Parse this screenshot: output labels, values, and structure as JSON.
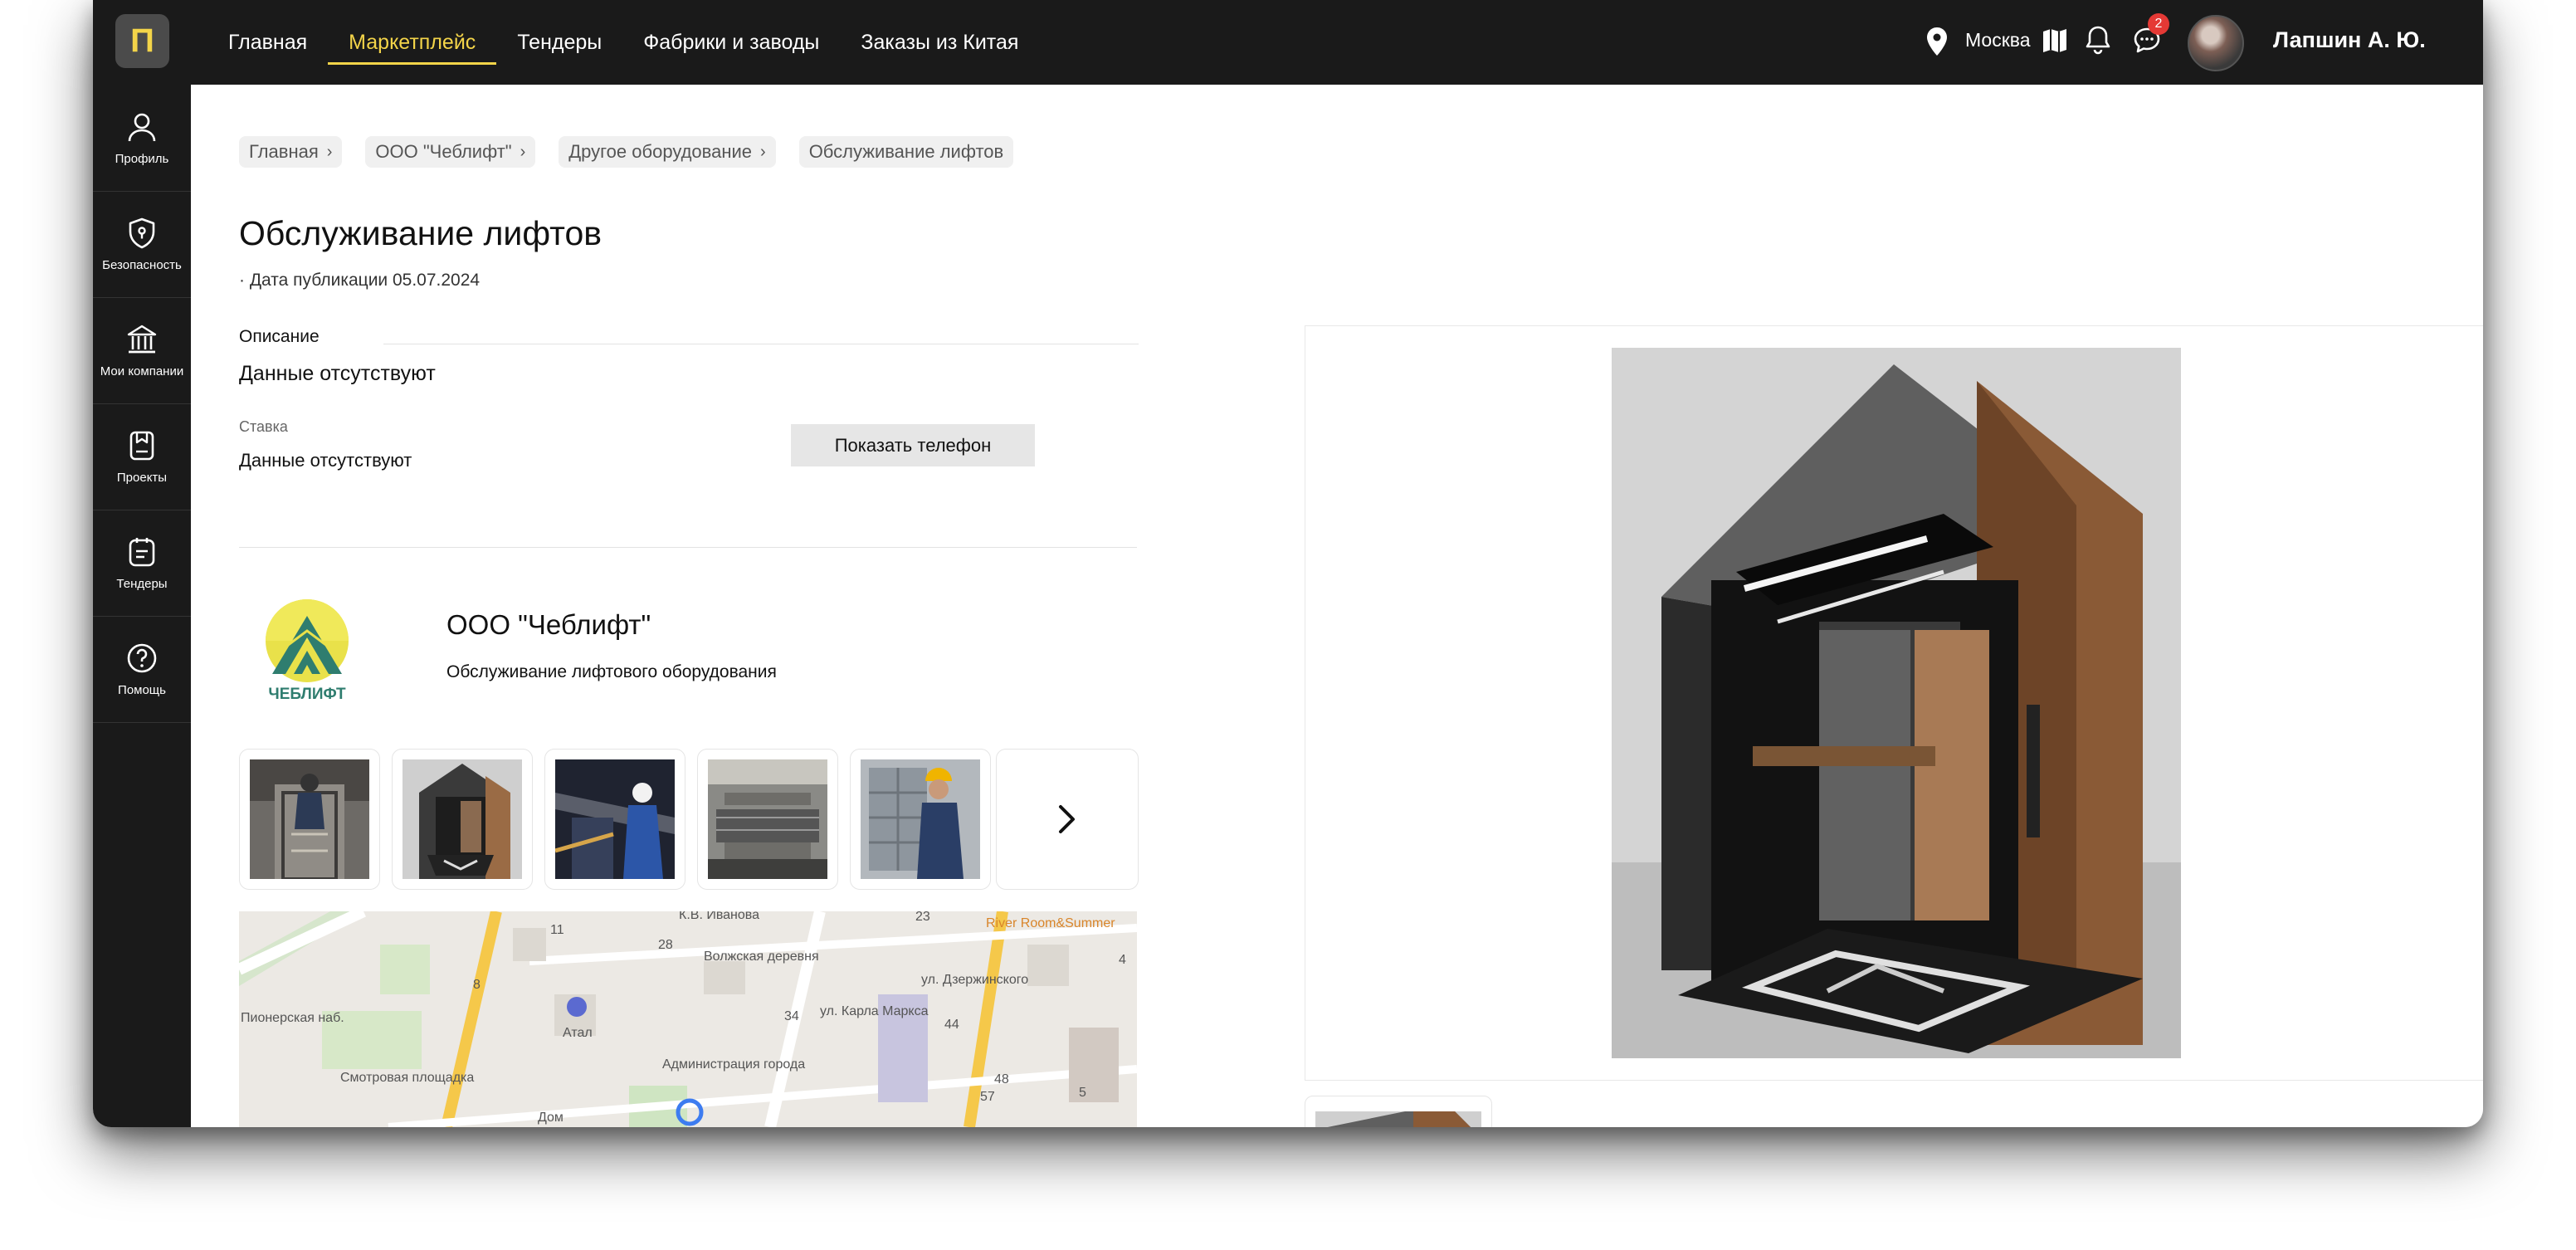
{
  "app": {
    "logo_letter": "П",
    "accent": "#f3d449",
    "bar_color": "#1a1a1a"
  },
  "topnav": {
    "items": [
      {
        "label": "Главная",
        "active": false
      },
      {
        "label": "Маркетплейс",
        "active": true
      },
      {
        "label": "Тендеры",
        "active": false
      },
      {
        "label": "Фабрики и заводы",
        "active": false
      },
      {
        "label": "Заказы из Китая",
        "active": false
      }
    ],
    "city": "Москва",
    "notifications_count": "2",
    "user_name": "Лапшин А. Ю.",
    "icons": [
      "location-pin-icon",
      "map-icon",
      "bell-icon",
      "chat-icon"
    ]
  },
  "sidebar": {
    "items": [
      {
        "label": "Профиль",
        "icon": "user-icon"
      },
      {
        "label": "Безопасность",
        "icon": "shield-icon"
      },
      {
        "label": "Мои компании",
        "icon": "building-icon"
      },
      {
        "label": "Проекты",
        "icon": "projects-icon"
      },
      {
        "label": "Тендеры",
        "icon": "tenders-icon"
      },
      {
        "label": "Помощь",
        "icon": "help-icon"
      }
    ]
  },
  "breadcrumbs": [
    {
      "label": "Главная"
    },
    {
      "label": "ООО \"Чеблифт\""
    },
    {
      "label": "Другое оборудование"
    },
    {
      "label": "Обслуживание лифтов"
    }
  ],
  "listing": {
    "title": "Обслуживание лифтов",
    "pub_date": "· Дата публикации 05.07.2024",
    "description_label": "Описание",
    "description_value": "Данные отсутствуют",
    "rate_label": "Ставка",
    "rate_value": "Данные отсутствуют",
    "show_phone_label": "Показать телефон"
  },
  "company": {
    "logo_text": "ЧЕБЛИФТ",
    "name": "ООО \"Чеблифт\"",
    "subtitle": "Обслуживание лифтового оборудования",
    "thumbnails": [
      "elevator-shaft-worker",
      "elevator-cabin-render",
      "technicians-working",
      "machine-room",
      "engineer-at-panel"
    ]
  },
  "map": {
    "labels": [
      "К.В. Иванова",
      "River Room&Summer",
      "Волжская деревня",
      "ул. Дзержинского",
      "ул. Карла Маркса",
      "Пионерская наб.",
      "Атал",
      "Смотровая площадка",
      "Администрация города",
      "Дом"
    ],
    "house_numbers": [
      "11",
      "28",
      "34",
      "44",
      "48",
      "57",
      "5",
      "4",
      "8",
      "23"
    ]
  }
}
